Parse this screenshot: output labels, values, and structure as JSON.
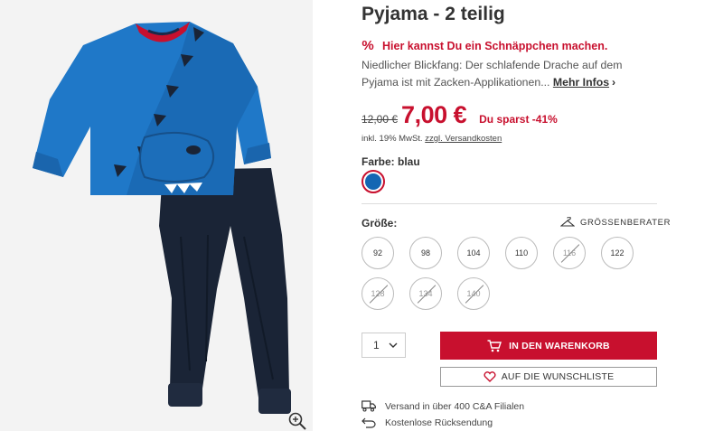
{
  "product": {
    "title": "Pyjama - 2 teilig",
    "deal_icon": "%",
    "deal_text": "Hier kannst Du ein Schnäppchen machen.",
    "description": "Niedlicher Blickfang: Der schlafende Drache auf dem Pyjama ist mit Zacken-Applikationen...",
    "more_info": "Mehr Infos",
    "more_arrow": "›"
  },
  "price": {
    "old": "12,00 €",
    "new": "7,00 €",
    "saving": "Du sparst -41%",
    "vat": "inkl. 19% MwSt.",
    "shipping": "zzgl. Versandkosten"
  },
  "color": {
    "label": "Farbe: blau",
    "swatch_color": "#1466b3"
  },
  "size": {
    "label": "Größe:",
    "advisor": "GRÖSSENBERATER",
    "options": [
      {
        "label": "92",
        "available": true
      },
      {
        "label": "98",
        "available": true
      },
      {
        "label": "104",
        "available": true
      },
      {
        "label": "110",
        "available": true
      },
      {
        "label": "116",
        "available": false
      },
      {
        "label": "122",
        "available": true
      },
      {
        "label": "128",
        "available": false
      },
      {
        "label": "134",
        "available": false
      },
      {
        "label": "140",
        "available": false
      }
    ]
  },
  "quantity": {
    "value": "1",
    "chevron": "⌄"
  },
  "actions": {
    "cart": "IN DEN WARENKORB",
    "wishlist": "AUF DIE WUNSCHLISTE"
  },
  "features": [
    {
      "text": "Versand in über 400 C&A Filialen",
      "icon": "truck-icon"
    },
    {
      "text": "Kostenlose Rücksendung",
      "icon": "return-icon"
    }
  ],
  "colors": {
    "accent": "#c8102e",
    "text": "#333333",
    "image_bg": "#f3f3f3"
  }
}
